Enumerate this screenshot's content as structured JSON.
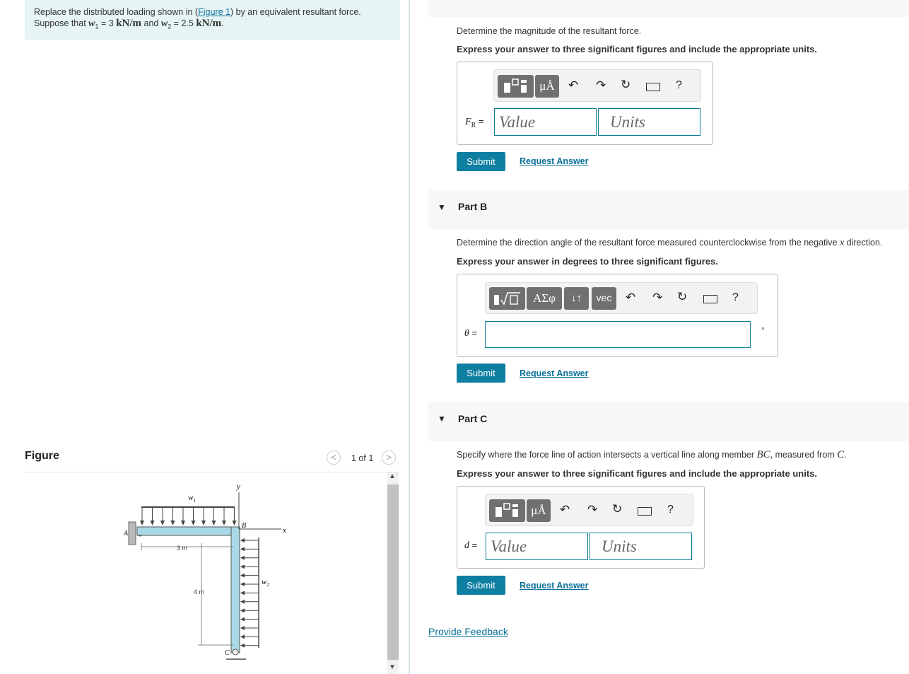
{
  "problem": {
    "line1_pre": "Replace the distributed loading shown in (",
    "line1_link": "Figure 1",
    "line1_post": ") by an equivalent resultant force.",
    "line2_pre": "Suppose that ",
    "w1": "w",
    "w1_sub": "1",
    "eq1": " = 3 ",
    "unit1": "kN/m",
    "mid": " and ",
    "w2": "w",
    "w2_sub": "2",
    "eq2": " = 2.5 ",
    "unit2": "kN/m",
    "end": "."
  },
  "figure_panel": {
    "title": "Figure",
    "prev_icon": "<",
    "page": "1 of 1",
    "next_icon": ">",
    "labels": {
      "w1": "w",
      "w1_sub": "1",
      "w2": "w",
      "w2_sub": "2",
      "y": "y",
      "x": "x",
      "A": "A",
      "B": "B",
      "C": "C",
      "dim_3m": "3 m",
      "dim_4m": "4 m"
    }
  },
  "part_a": {
    "question": "Determine the magnitude of the resultant force.",
    "instruction": "Express your answer to three significant figures and include the appropriate units.",
    "toolbar": {
      "mu_label": "μÅ",
      "help": "?"
    },
    "var_label": "F",
    "var_sub": "R",
    "equals": " =",
    "value_placeholder": "Value",
    "units_placeholder": "Units",
    "submit": "Submit",
    "request": "Request Answer"
  },
  "part_b": {
    "caret": "▼",
    "title": "Part B",
    "question": "Determine the direction angle of the resultant force measured counterclockwise from the negative ",
    "question_var": "x",
    "question_end": " direction.",
    "instruction": "Express your answer in degrees to three significant figures.",
    "toolbar": {
      "greek": "ΑΣφ",
      "arrows": "↓↑",
      "vec": "vec",
      "help": "?"
    },
    "var_label": "θ",
    "equals": " =",
    "degree": "°",
    "submit": "Submit",
    "request": "Request Answer"
  },
  "part_c": {
    "caret": "▼",
    "title": "Part C",
    "question_pre": "Specify where the force line of action intersects a vertical line along member ",
    "question_bc": "BC",
    "question_mid": ", measured from ",
    "question_c": "C",
    "question_end": ".",
    "instruction": "Express your answer to three significant figures and include the appropriate units.",
    "toolbar": {
      "mu_label": "μÅ",
      "help": "?"
    },
    "var_label": "d",
    "equals": " =",
    "value_placeholder": "Value",
    "units_placeholder": "Units",
    "submit": "Submit",
    "request": "Request Answer"
  },
  "feedback": "Provide Feedback",
  "colors": {
    "accent": "#0e7ea1",
    "link": "#0a6f9a",
    "problem_bg": "#e6f4f5",
    "beam": "#a9d8e6"
  },
  "icons": [
    "template-icon",
    "undo-icon",
    "redo-icon",
    "reset-icon",
    "keyboard-icon",
    "help-icon",
    "radical-icon",
    "caret-down-icon"
  ]
}
